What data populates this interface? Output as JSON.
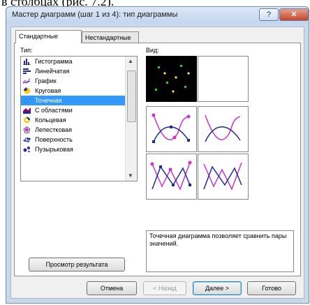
{
  "caption": "в столбцах (рис. 7.2).",
  "window": {
    "title": "Мастер диаграмм (шаг 1 из 4): тип диаграммы",
    "help_label": "?",
    "close_label": "✕"
  },
  "tabs": [
    {
      "label": "Стандартные"
    },
    {
      "label": "Нестандартные"
    }
  ],
  "type_label": "Тип:",
  "view_label": "Вид:",
  "chart_types": [
    {
      "label": "Гистограмма",
      "icon": "histogram-icon"
    },
    {
      "label": "Линейчатая",
      "icon": "bar-icon"
    },
    {
      "label": "График",
      "icon": "line-chart-icon"
    },
    {
      "label": "Круговая",
      "icon": "pie-icon"
    },
    {
      "label": "Точечная",
      "icon": "scatter-icon",
      "selected": true
    },
    {
      "label": "С областями",
      "icon": "area-icon"
    },
    {
      "label": "Кольцевая",
      "icon": "doughnut-icon"
    },
    {
      "label": "Лепестковая",
      "icon": "radar-icon"
    },
    {
      "label": "Поверхность",
      "icon": "surface-icon"
    },
    {
      "label": "Пузырьковая",
      "icon": "bubble-icon"
    }
  ],
  "description": "Точечная диаграмма позволяет сравнить пары значений.",
  "buttons": {
    "preview": "Просмотр результата",
    "cancel": "Отмена",
    "back": "< Назад",
    "next": "Далее >",
    "finish": "Готово"
  },
  "colors": {
    "selection": "#3399ff",
    "preview_magenta": "#cc33cc",
    "preview_navy": "#1f2b8f",
    "preview_points": "#33cc33"
  }
}
